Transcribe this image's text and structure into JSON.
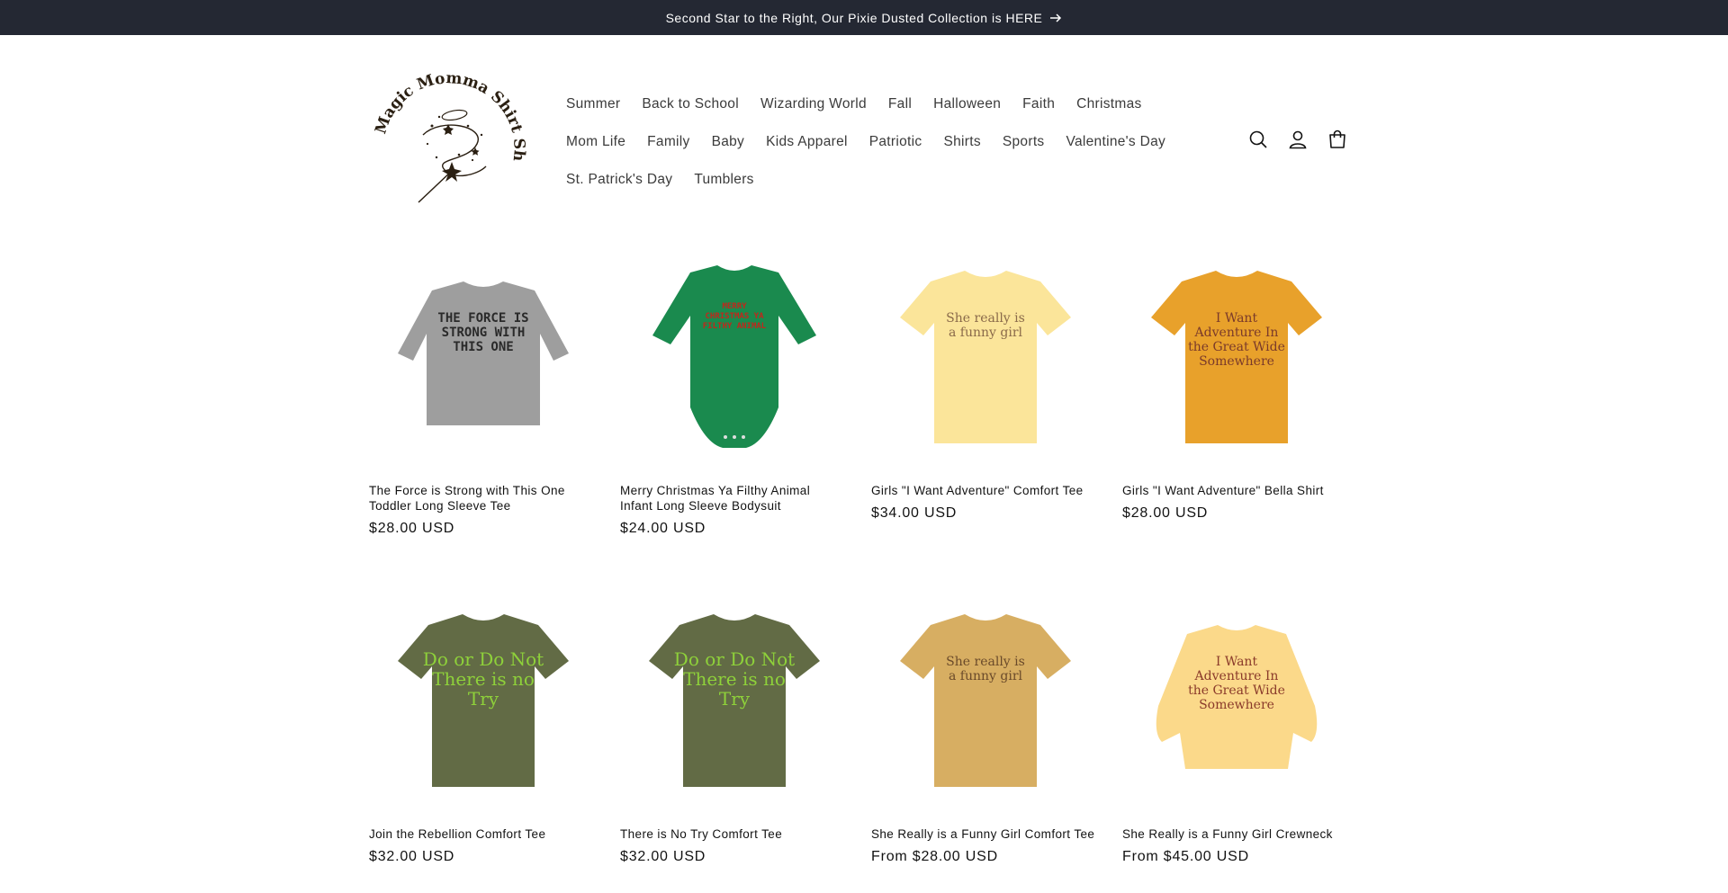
{
  "announcement": {
    "text": "Second Star to the Right, Our Pixie Dusted Collection is HERE"
  },
  "logo": {
    "alt": "Magic Momma Shirt Shop",
    "text": "Magic Momma Shirt Shop"
  },
  "nav": {
    "row1": [
      "Summer",
      "Back to School",
      "Wizarding World",
      "Fall",
      "Halloween",
      "Faith",
      "Christmas"
    ],
    "row2": [
      "Mom Life",
      "Family",
      "Baby",
      "Kids Apparel",
      "Patriotic",
      "Shirts",
      "Sports",
      "Valentine's Day"
    ],
    "row3": [
      "St. Patrick's Day",
      "Tumblers"
    ]
  },
  "header_icons": [
    "search-icon",
    "account-icon",
    "cart-icon"
  ],
  "products": [
    {
      "title": "The Force is Strong with This One Toddler Long Sleeve Tee",
      "price": "$28.00 USD",
      "shirt_color": "#9e9e9e",
      "print": "THE FORCE IS STRONG WITH THIS ONE",
      "print_color": "#2a2a2a",
      "style": "longsleeve"
    },
    {
      "title": "Merry Christmas Ya Filthy Animal Infant Long Sleeve Bodysuit",
      "price": "$24.00 USD",
      "shirt_color": "#1a8a4e",
      "print": "MERRY CHRISTMAS YA FILTHY ANIMAL",
      "print_color": "#c0281c",
      "style": "onesie"
    },
    {
      "title": "Girls \"I Want Adventure\" Comfort Tee",
      "price": "$34.00 USD",
      "shirt_color": "#fbe59a",
      "print": "She really is a funny girl",
      "print_color": "#8a6a4a",
      "style": "tee"
    },
    {
      "title": "Girls \"I Want Adventure\" Bella Shirt",
      "price": "$28.00 USD",
      "shirt_color": "#e8a12b",
      "print": "I Want Adventure In the Great Wide Somewhere",
      "print_color": "#7a3a2a",
      "style": "tee"
    },
    {
      "title": "Join the Rebellion Comfort Tee",
      "price": "$32.00 USD",
      "shirt_color": "#626b45",
      "print": "Do or Do Not There is no Try",
      "print_color": "#8ed13a",
      "style": "tee"
    },
    {
      "title": "There is No Try Comfort Tee",
      "price": "$32.00 USD",
      "shirt_color": "#626b45",
      "print": "Do or Do Not There is no Try",
      "print_color": "#8ed13a",
      "style": "tee"
    },
    {
      "title": "She Really is a Funny Girl Comfort Tee",
      "price": "From $28.00 USD",
      "shirt_color": "#d7ae62",
      "print": "She really is a funny girl",
      "print_color": "#6a4a2a",
      "style": "tee"
    },
    {
      "title": "She Really is a Funny Girl Crewneck",
      "price": "From $45.00 USD",
      "shirt_color": "#fbd98a",
      "print": "I Want Adventure In the Great Wide Somewhere",
      "print_color": "#8a3a2a",
      "style": "crewneck"
    }
  ]
}
